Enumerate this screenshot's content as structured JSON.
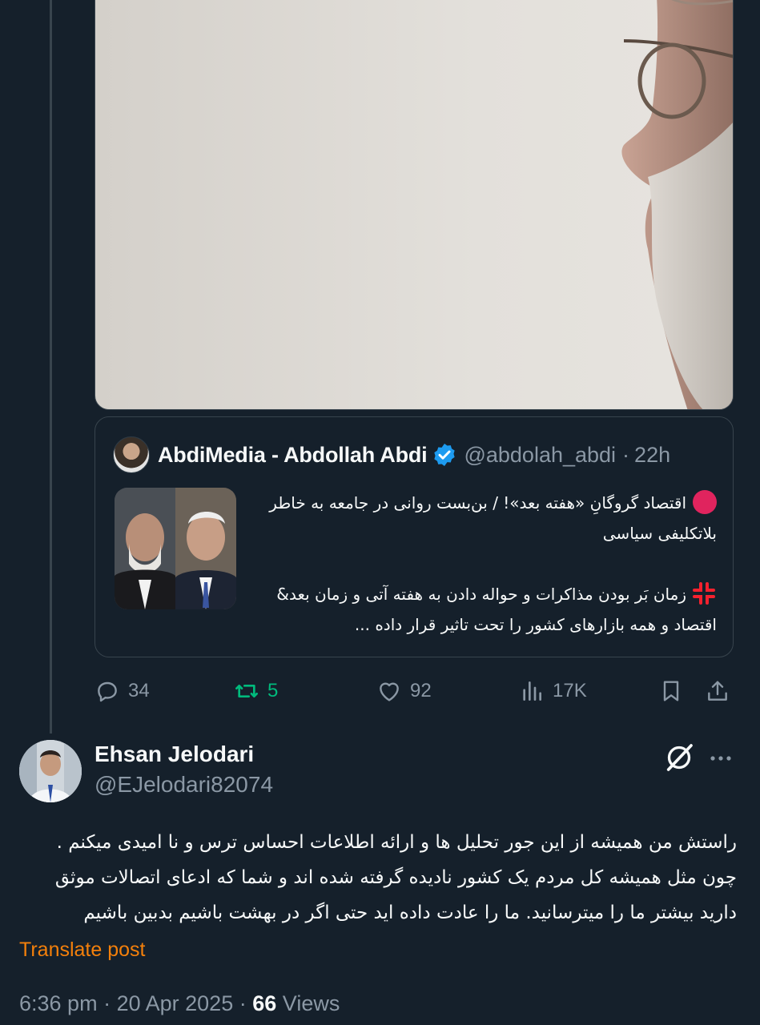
{
  "quoted_tweet": {
    "author_name": "AbdiMedia - Abdollah Abdi",
    "author_handle": "@abdolah_abdi",
    "time_ago": "22h",
    "line1": "اقتصاد گروگانِ «هفته بعد»! / بن‌بست روانی در جامعه به خاطر بلاتکلیفی سیاسی",
    "line2": "زمان بَر بودن مذاکرات و حواله دادن به هفته آتی و زمان بعد& اقتصاد و همه بازارهای کشور را تحت تاثیر قرار داده ..."
  },
  "parent_actions": {
    "replies": "34",
    "reposts": "5",
    "likes": "92",
    "views": "17K"
  },
  "post": {
    "author_name": "Ehsan Jelodari",
    "author_handle": "@EJelodari82074",
    "text": "راستش من همیشه از این جور تحلیل ها و ارائه اطلاعات احساس ترس و نا امیدی میکنم . چون مثل همیشه کل مردم یک کشور نادیده گرفته شده اند و شما که ادعای اتصالات موثق دارید بیشتر ما را میترسانید. ما را عادت داده اید حتی اگر در بهشت باشیم بدبین باشیم",
    "translate_label": "Translate post",
    "time": "6:36 pm",
    "date": "20 Apr 2025",
    "views_count": "66",
    "views_label": "Views"
  },
  "colors": {
    "background": "#15202b",
    "text_secondary": "#8b98a5",
    "border": "#38444d",
    "verified_blue": "#1d9bf0",
    "repost_green": "#00ba7c",
    "translate_orange": "#f4800b"
  },
  "icons": [
    "verified-badge-icon",
    "reply-icon",
    "repost-icon",
    "like-icon",
    "views-icon",
    "bookmark-icon",
    "share-icon",
    "grok-icon",
    "more-icon",
    "red-circle-emoji-icon",
    "anger-emoji-icon"
  ]
}
